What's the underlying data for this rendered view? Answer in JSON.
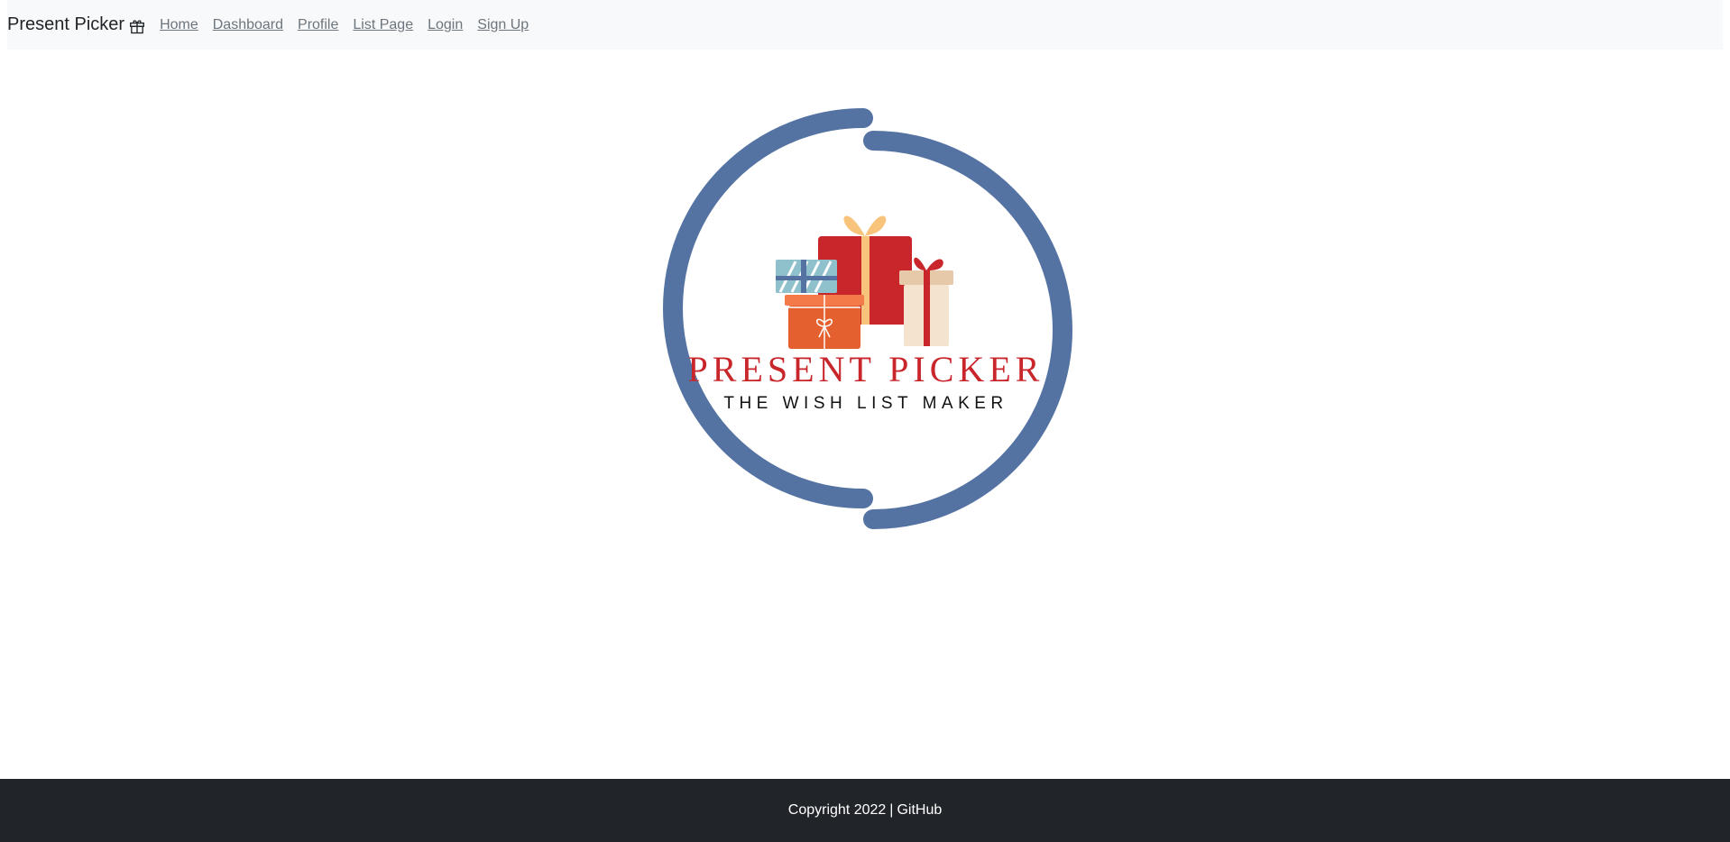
{
  "navbar": {
    "brand": "Present Picker",
    "brand_icon": "gift-icon",
    "links": [
      "Home",
      "Dashboard",
      "Profile",
      "List Page",
      "Login",
      "Sign Up"
    ]
  },
  "hero": {
    "title": "PRESENT PICKER",
    "subtitle": "THE WISH LIST MAKER",
    "colors": {
      "ring": "#5473a3",
      "title": "#c8262b",
      "subtitle": "#111111"
    }
  },
  "footer": {
    "copyright": "Copyright 2022",
    "separator": "|",
    "github": "GitHub"
  }
}
